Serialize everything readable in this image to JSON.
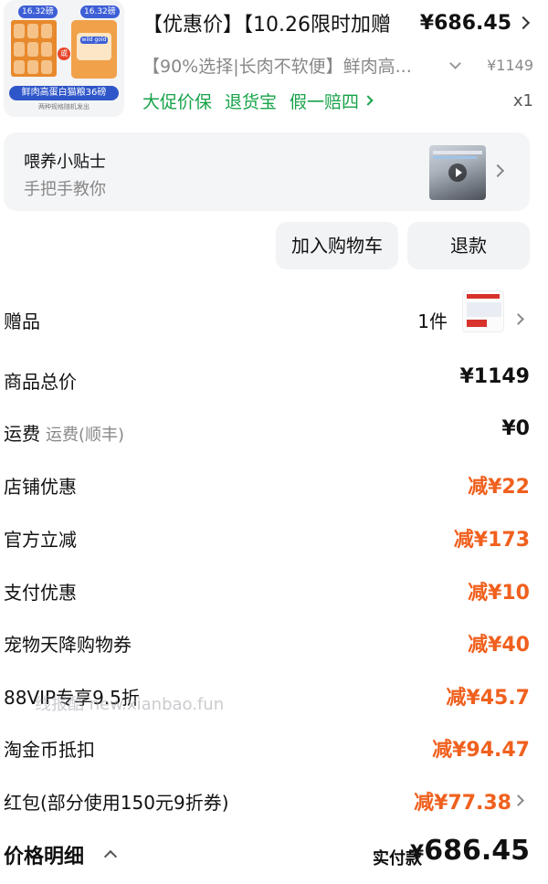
{
  "product": {
    "image_banner": "鲜肉高蛋白猫粮36磅",
    "image_subtext": "两种规格随机发出",
    "image_badge_left": "16.32磅",
    "image_badge_right": "16.32磅",
    "image_brand": "wild gold",
    "image_or": "或",
    "title": "【优惠价】【10.26限时加赠",
    "title_price": "¥686.45",
    "sku": "【90%选择|长肉不软便】鲜肉高...",
    "sku_price": "¥1149",
    "tags": [
      "大促价保",
      "退货宝",
      "假一赔四"
    ],
    "quantity": "x1"
  },
  "tips": {
    "title": "喂养小贴士",
    "subtitle": "手把手教你"
  },
  "buttons": {
    "add_to_cart": "加入购物车",
    "refund": "退款"
  },
  "gift": {
    "label": "赠品",
    "count": "1件"
  },
  "rows": {
    "total": {
      "label": "商品总价",
      "value": "¥1149"
    },
    "shipping": {
      "label": "运费",
      "sublabel": "运费(顺丰)",
      "value": "¥0"
    },
    "shop_discount": {
      "label": "店铺优惠",
      "value": "减¥22"
    },
    "official_discount": {
      "label": "官方立减",
      "value": "减¥173"
    },
    "payment_discount": {
      "label": "支付优惠",
      "value": "减¥10"
    },
    "pet_coupon": {
      "label": "宠物天降购物券",
      "value": "减¥40"
    },
    "vip": {
      "label": "88VIP专享9.5折",
      "value": "减¥45.7"
    },
    "coins": {
      "label": "淘金币抵扣",
      "value": "减¥94.47"
    },
    "redpacket": {
      "label": "红包(部分使用150元9折券)",
      "value": "减¥77.38"
    }
  },
  "watermark": "线报酷 new.xianbao.fun",
  "footer": {
    "title": "价格明细",
    "paid_label": "实付款",
    "currency": "¥",
    "paid_value": "686.45"
  },
  "colors": {
    "discount": "#f0601e",
    "tag_green": "#17a34a",
    "card_bg": "#f4f5f7"
  }
}
